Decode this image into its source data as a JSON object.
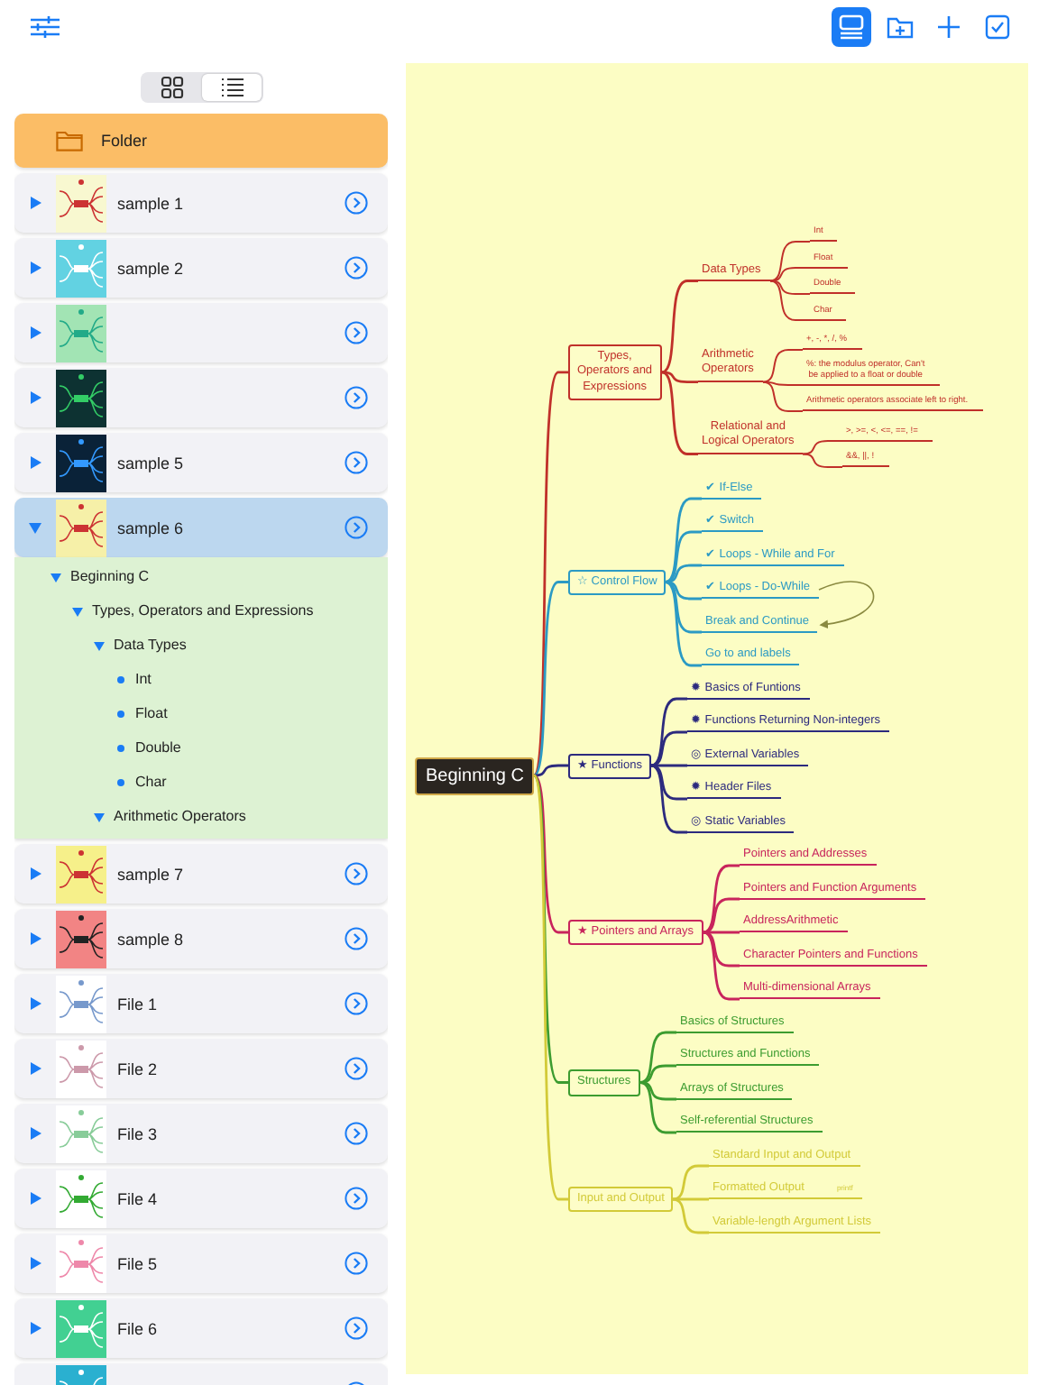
{
  "toolbar": {
    "left": [
      {
        "kind": "filters"
      }
    ],
    "right": [
      {
        "kind": "layout",
        "selected": true
      },
      {
        "kind": "new-folder",
        "selected": false
      },
      {
        "kind": "add",
        "selected": false
      },
      {
        "kind": "select",
        "selected": false
      }
    ]
  },
  "view_modes": [
    {
      "kind": "grid",
      "selected": false
    },
    {
      "kind": "list",
      "selected": true
    }
  ],
  "rows": [
    {
      "kind": "folder",
      "label": "Folder",
      "selected": false
    },
    {
      "kind": "file",
      "label": "sample 1",
      "expanded": false,
      "selected": false
    },
    {
      "kind": "file",
      "label": "sample 2",
      "expanded": false,
      "selected": false
    },
    {
      "kind": "file",
      "expanded": false,
      "selected": false
    },
    {
      "kind": "file",
      "expanded": false,
      "selected": false
    },
    {
      "kind": "file",
      "label": "sample 5",
      "expanded": false,
      "selected": false
    },
    {
      "kind": "file",
      "label": "sample 6",
      "expanded": true,
      "selected": true,
      "outline": [
        {
          "kind": "branch",
          "label": "Beginning C",
          "expanded": true,
          "children": [
            {
              "kind": "branch",
              "label": "Types,  Operators and Expressions",
              "expanded": true,
              "children": [
                {
                  "kind": "branch",
                  "label": "Data Types",
                  "expanded": true,
                  "children": [
                    {
                      "kind": "leaf",
                      "label": "Int"
                    },
                    {
                      "kind": "leaf",
                      "label": "Float"
                    },
                    {
                      "kind": "leaf",
                      "label": "Double"
                    },
                    {
                      "kind": "leaf",
                      "label": "Char"
                    }
                  ]
                },
                {
                  "kind": "branch",
                  "label": "Arithmetic Operators",
                  "expanded": true
                }
              ]
            }
          ]
        }
      ]
    },
    {
      "kind": "file",
      "label": "sample 7",
      "expanded": false,
      "selected": false
    },
    {
      "kind": "file",
      "label": "sample 8",
      "expanded": false,
      "selected": false
    },
    {
      "kind": "file",
      "label": "File 1",
      "expanded": false,
      "selected": false
    },
    {
      "kind": "file",
      "label": "File 2",
      "expanded": false,
      "selected": false
    },
    {
      "kind": "file",
      "label": "File 3",
      "expanded": false,
      "selected": false
    },
    {
      "kind": "file",
      "label": "File 4",
      "expanded": false,
      "selected": false
    },
    {
      "kind": "file",
      "label": "File 5",
      "expanded": false,
      "selected": false
    },
    {
      "kind": "file",
      "label": "File 6",
      "expanded": false,
      "selected": false
    },
    {
      "kind": "file",
      "selected": false
    }
  ],
  "mind_map": {
    "root": {
      "label": "Beginning C",
      "children": [
        {
          "label": "Types,\nOperators and\nExpressions",
          "color": "#c0302a",
          "children": [
            {
              "label": "Data Types",
              "children": [
                {
                  "label": "Int"
                },
                {
                  "label": "Float"
                },
                {
                  "label": "Double"
                },
                {
                  "label": "Char"
                }
              ]
            },
            {
              "label": "Arithmetic\nOperators",
              "children": [
                {
                  "label": "+, -, *, /, %"
                },
                {
                  "label": "%: the modulus operator,   Can't\nbe applied to a float or double"
                },
                {
                  "label": "Arithmetic operators associate left to right."
                }
              ]
            },
            {
              "label": "Relational and\nLogical Operators",
              "children": [
                {
                  "label": ">, >=, <, <=, ==, !="
                },
                {
                  "label": "&&, ||, !"
                }
              ]
            }
          ]
        },
        {
          "label": "☆ Control Flow",
          "color": "#2b9ac4",
          "children": [
            {
              "label": "✔ If-Else"
            },
            {
              "label": "✔ Switch"
            },
            {
              "label": "✔ Loops - While and For"
            },
            {
              "label": "✔ Loops - Do-While",
              "arrow_to_next": true
            },
            {
              "label": "Break and Continue"
            },
            {
              "label": "Go to and labels"
            }
          ]
        },
        {
          "label": "★ Functions",
          "color": "#2c2a7e",
          "children": [
            {
              "label": "✹ Basics of Funtions"
            },
            {
              "label": "✹   Functions Returning Non-integers"
            },
            {
              "label": "◎ External Variables"
            },
            {
              "label": "✹ Header Files"
            },
            {
              "label": "◎ Static Variables"
            }
          ]
        },
        {
          "label": "★ Pointers and Arrays",
          "color": "#c8245c",
          "children": [
            {
              "label": "Pointers and Addresses"
            },
            {
              "label": "Pointers and Function Arguments"
            },
            {
              "label": "AddressArithmetic"
            },
            {
              "label": "Character Pointers and Functions"
            },
            {
              "label": "Multi-dimensional Arrays"
            }
          ]
        },
        {
          "label": "Structures",
          "color": "#3c9c30",
          "children": [
            {
              "label": "Basics of Structures"
            },
            {
              "label": "Structures and Functions"
            },
            {
              "label": "Arrays of Structures"
            },
            {
              "label": "Self-referential Structures"
            }
          ]
        },
        {
          "label": "Input and Output",
          "color": "#d2ca38",
          "children": [
            {
              "label": "Standard Input and Output"
            },
            {
              "label": "Formatted Output",
              "note": "printf"
            },
            {
              "label": "Variable-length Argument Lists"
            }
          ]
        }
      ]
    }
  }
}
